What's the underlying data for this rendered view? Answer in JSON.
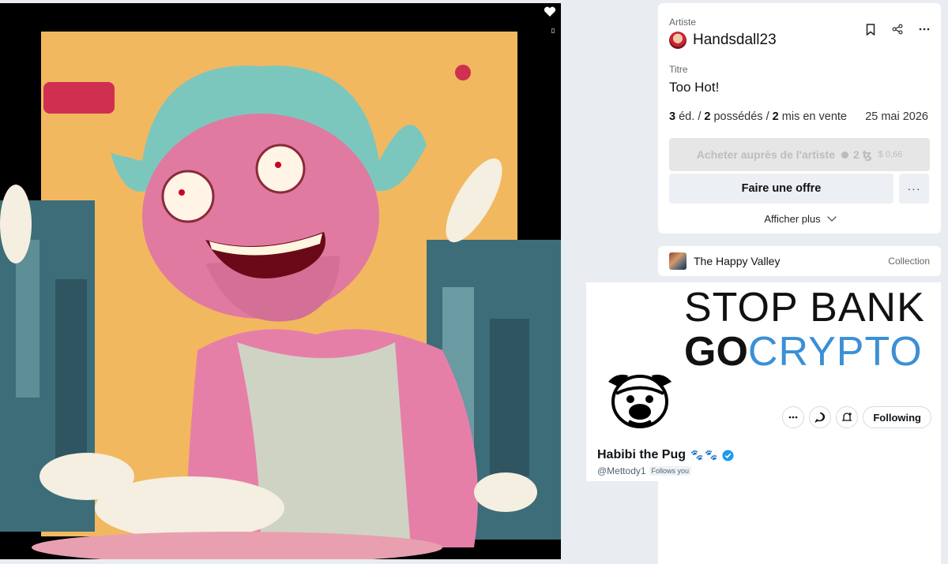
{
  "artwork": {
    "alt": "Too Hot!"
  },
  "info": {
    "artist_label": "Artiste",
    "artist_name": "Handsdall23",
    "title_label": "Titre",
    "title": "Too Hot!",
    "editions_count": "3",
    "editions_unit": "éd.",
    "owned_count": "2",
    "owned_unit": "possédés",
    "for_sale_count": "2",
    "for_sale_unit": "mis en vente",
    "separator": "/",
    "date": "25 mai 2026",
    "buy_label": "Acheter auprès de l'artiste",
    "buy_price": "2 ꜩ",
    "buy_usd": "$ 0,66",
    "offer_label": "Faire une offre",
    "more_label": "···",
    "show_more_label": "Afficher plus"
  },
  "collection": {
    "name": "The Happy Valley",
    "tag": "Collection"
  },
  "twitter": {
    "banner_line1": "STOP BANK",
    "banner_go": "GO",
    "banner_crypto": "CRYPTO",
    "display_name": "Habibi the Pug",
    "paws": "🐾🐾",
    "handle": "@Mettody1",
    "follows_you": "Follows you",
    "following_label": "Following"
  },
  "colors": {
    "crypto_blue": "#3b8fd6",
    "verified_blue": "#1d9bf0"
  }
}
